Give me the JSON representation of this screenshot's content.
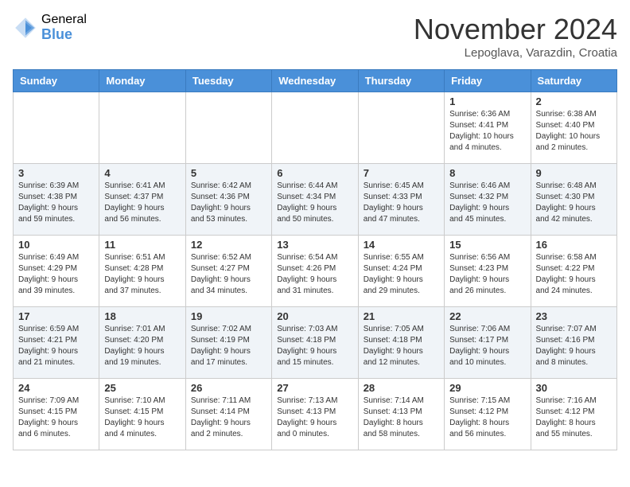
{
  "header": {
    "logo_general": "General",
    "logo_blue": "Blue",
    "month_title": "November 2024",
    "location": "Lepoglava, Varazdin, Croatia"
  },
  "days_of_week": [
    "Sunday",
    "Monday",
    "Tuesday",
    "Wednesday",
    "Thursday",
    "Friday",
    "Saturday"
  ],
  "weeks": [
    [
      {
        "day": "",
        "info": ""
      },
      {
        "day": "",
        "info": ""
      },
      {
        "day": "",
        "info": ""
      },
      {
        "day": "",
        "info": ""
      },
      {
        "day": "",
        "info": ""
      },
      {
        "day": "1",
        "info": "Sunrise: 6:36 AM\nSunset: 4:41 PM\nDaylight: 10 hours\nand 4 minutes."
      },
      {
        "day": "2",
        "info": "Sunrise: 6:38 AM\nSunset: 4:40 PM\nDaylight: 10 hours\nand 2 minutes."
      }
    ],
    [
      {
        "day": "3",
        "info": "Sunrise: 6:39 AM\nSunset: 4:38 PM\nDaylight: 9 hours\nand 59 minutes."
      },
      {
        "day": "4",
        "info": "Sunrise: 6:41 AM\nSunset: 4:37 PM\nDaylight: 9 hours\nand 56 minutes."
      },
      {
        "day": "5",
        "info": "Sunrise: 6:42 AM\nSunset: 4:36 PM\nDaylight: 9 hours\nand 53 minutes."
      },
      {
        "day": "6",
        "info": "Sunrise: 6:44 AM\nSunset: 4:34 PM\nDaylight: 9 hours\nand 50 minutes."
      },
      {
        "day": "7",
        "info": "Sunrise: 6:45 AM\nSunset: 4:33 PM\nDaylight: 9 hours\nand 47 minutes."
      },
      {
        "day": "8",
        "info": "Sunrise: 6:46 AM\nSunset: 4:32 PM\nDaylight: 9 hours\nand 45 minutes."
      },
      {
        "day": "9",
        "info": "Sunrise: 6:48 AM\nSunset: 4:30 PM\nDaylight: 9 hours\nand 42 minutes."
      }
    ],
    [
      {
        "day": "10",
        "info": "Sunrise: 6:49 AM\nSunset: 4:29 PM\nDaylight: 9 hours\nand 39 minutes."
      },
      {
        "day": "11",
        "info": "Sunrise: 6:51 AM\nSunset: 4:28 PM\nDaylight: 9 hours\nand 37 minutes."
      },
      {
        "day": "12",
        "info": "Sunrise: 6:52 AM\nSunset: 4:27 PM\nDaylight: 9 hours\nand 34 minutes."
      },
      {
        "day": "13",
        "info": "Sunrise: 6:54 AM\nSunset: 4:26 PM\nDaylight: 9 hours\nand 31 minutes."
      },
      {
        "day": "14",
        "info": "Sunrise: 6:55 AM\nSunset: 4:24 PM\nDaylight: 9 hours\nand 29 minutes."
      },
      {
        "day": "15",
        "info": "Sunrise: 6:56 AM\nSunset: 4:23 PM\nDaylight: 9 hours\nand 26 minutes."
      },
      {
        "day": "16",
        "info": "Sunrise: 6:58 AM\nSunset: 4:22 PM\nDaylight: 9 hours\nand 24 minutes."
      }
    ],
    [
      {
        "day": "17",
        "info": "Sunrise: 6:59 AM\nSunset: 4:21 PM\nDaylight: 9 hours\nand 21 minutes."
      },
      {
        "day": "18",
        "info": "Sunrise: 7:01 AM\nSunset: 4:20 PM\nDaylight: 9 hours\nand 19 minutes."
      },
      {
        "day": "19",
        "info": "Sunrise: 7:02 AM\nSunset: 4:19 PM\nDaylight: 9 hours\nand 17 minutes."
      },
      {
        "day": "20",
        "info": "Sunrise: 7:03 AM\nSunset: 4:18 PM\nDaylight: 9 hours\nand 15 minutes."
      },
      {
        "day": "21",
        "info": "Sunrise: 7:05 AM\nSunset: 4:18 PM\nDaylight: 9 hours\nand 12 minutes."
      },
      {
        "day": "22",
        "info": "Sunrise: 7:06 AM\nSunset: 4:17 PM\nDaylight: 9 hours\nand 10 minutes."
      },
      {
        "day": "23",
        "info": "Sunrise: 7:07 AM\nSunset: 4:16 PM\nDaylight: 9 hours\nand 8 minutes."
      }
    ],
    [
      {
        "day": "24",
        "info": "Sunrise: 7:09 AM\nSunset: 4:15 PM\nDaylight: 9 hours\nand 6 minutes."
      },
      {
        "day": "25",
        "info": "Sunrise: 7:10 AM\nSunset: 4:15 PM\nDaylight: 9 hours\nand 4 minutes."
      },
      {
        "day": "26",
        "info": "Sunrise: 7:11 AM\nSunset: 4:14 PM\nDaylight: 9 hours\nand 2 minutes."
      },
      {
        "day": "27",
        "info": "Sunrise: 7:13 AM\nSunset: 4:13 PM\nDaylight: 9 hours\nand 0 minutes."
      },
      {
        "day": "28",
        "info": "Sunrise: 7:14 AM\nSunset: 4:13 PM\nDaylight: 8 hours\nand 58 minutes."
      },
      {
        "day": "29",
        "info": "Sunrise: 7:15 AM\nSunset: 4:12 PM\nDaylight: 8 hours\nand 56 minutes."
      },
      {
        "day": "30",
        "info": "Sunrise: 7:16 AM\nSunset: 4:12 PM\nDaylight: 8 hours\nand 55 minutes."
      }
    ]
  ]
}
